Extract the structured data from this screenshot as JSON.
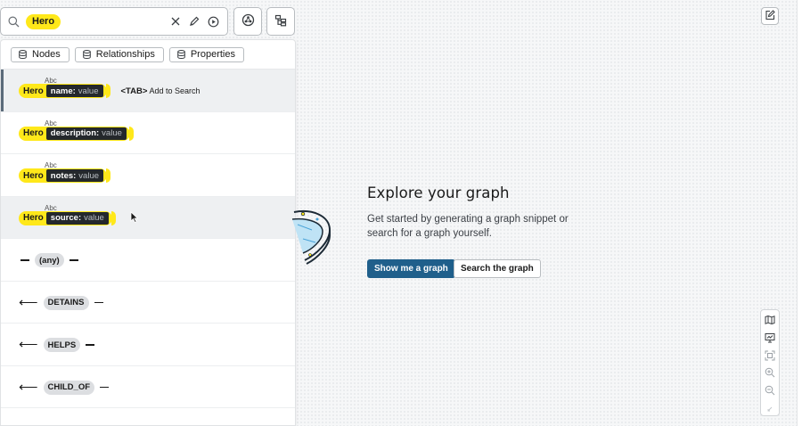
{
  "search": {
    "query_chip": "Hero"
  },
  "filters": {
    "nodes": "Nodes",
    "relationships": "Relationships",
    "properties": "Properties"
  },
  "suggestions": [
    {
      "type_hint": "Abc",
      "label": "Hero",
      "prop": "name:",
      "value": "value",
      "hint_key": "<TAB>",
      "hint_text": "Add to Search"
    },
    {
      "type_hint": "Abc",
      "label": "Hero",
      "prop": "description:",
      "value": "value"
    },
    {
      "type_hint": "Abc",
      "label": "Hero",
      "prop": "notes:",
      "value": "value"
    },
    {
      "type_hint": "Abc",
      "label": "Hero",
      "prop": "source:",
      "value": "value"
    }
  ],
  "relationships": [
    {
      "label": "(any)",
      "direction": "none"
    },
    {
      "label": "DETAINS",
      "direction": "left"
    },
    {
      "label": "HELPS",
      "direction": "left"
    },
    {
      "label": "CHILD_OF",
      "direction": "left"
    }
  ],
  "empty_state": {
    "title": "Explore your graph",
    "description": "Get started by generating a graph snippet or search for a graph yourself.",
    "primary_button": "Show me a graph",
    "secondary_button": "Search the graph"
  },
  "colors": {
    "accent_yellow": "#ffe81a",
    "primary_blue": "#1f5f8b",
    "dark_chip": "#24282c"
  },
  "icons": {
    "search": "magnifier-icon",
    "clear": "close-icon",
    "edit": "pencil-icon",
    "run": "play-circle-icon",
    "scene": "graph-settings-icon",
    "hierarchy": "hierarchy-icon",
    "note": "edit-note-icon",
    "map": "map-icon",
    "presentation": "presentation-icon",
    "fit": "fit-to-screen-icon",
    "zoom_in": "zoom-in-icon",
    "zoom_out": "zoom-out-icon",
    "collapse": "collapse-icon"
  }
}
